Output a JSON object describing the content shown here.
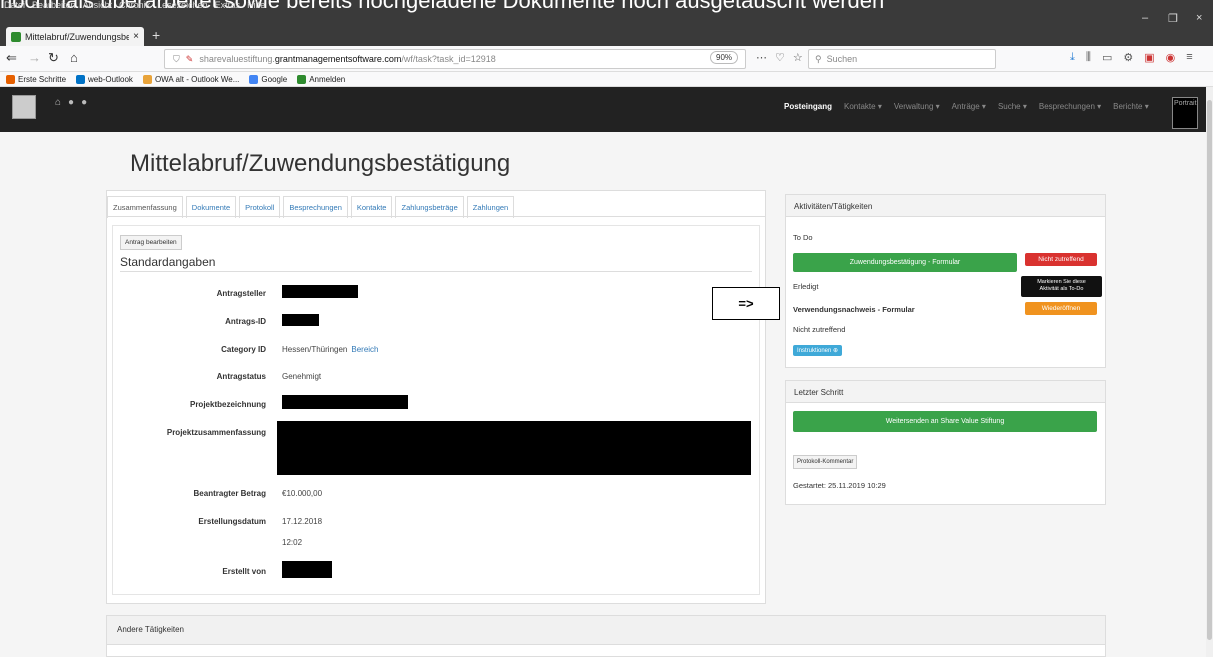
{
  "caption": "nochmals überarbeitet sowie bereits hochgeladene Dokumente noch ausgetauscht werden",
  "browser": {
    "menu": [
      "Datei",
      "Bearbeiten",
      "Ansicht",
      "Chronik",
      "Lesezeichen",
      "Extras",
      "Hilfe"
    ],
    "tab_title": "Mittelabruf/Zuwendungsbestä",
    "tab_close": "×",
    "newtab": "+",
    "url_prefix": "sharevaluestiftung.",
    "url_domain": "grantmanagementsoftware.com",
    "url_path": "/wf/task?task_id=12918",
    "zoom": "90%",
    "search_placeholder": "Suchen",
    "bookmarks": [
      "Erste Schritte",
      "web-Outlook",
      "OWA alt - Outlook We...",
      "Google",
      "Anmelden"
    ],
    "win_min": "–",
    "win_max": "❐",
    "win_close": "×"
  },
  "app": {
    "nav": [
      "Posteingang",
      "Kontakte ▾",
      "Verwaltung ▾",
      "Anträge ▾",
      "Suche ▾",
      "Besprechungen ▾",
      "Berichte ▾"
    ],
    "portrait": "Portrait"
  },
  "page": {
    "title": "Mittelabruf/Zuwendungsbestätigung",
    "tabs": [
      "Zusammenfassung",
      "Dokumente",
      "Protokoll",
      "Besprechungen",
      "Kontakte",
      "Zahlungsbeträge",
      "Zahlungen"
    ],
    "edit_button": "Antrag bearbeiten",
    "section_title": "Standardangaben",
    "fields": {
      "antragsteller": "Antragsteller",
      "antrags_id": "Antrags-ID",
      "category_id": "Category ID",
      "category_value": "Hessen/Thüringen",
      "category_link": "Bereich",
      "antragstatus": "Antragstatus",
      "antragstatus_value": "Genehmigt",
      "projektbezeichnung": "Projektbezeichnung",
      "projektzusammenfassung": "Projektzusammenfassung",
      "betrag": "Beantragter Betrag",
      "betrag_value": "€10.000,00",
      "datum": "Erstellungsdatum",
      "datum_value": "17.12.2018",
      "zeit_value": "12:02",
      "erstellt": "Erstellt von"
    },
    "arrow": "=>",
    "aktivitaeten": {
      "header": "Aktivitäten/Tätigkeiten",
      "todo": "To Do",
      "green_btn": "Zuwendungsbestätigung - Formular",
      "red_btn": "Nicht zutreffend",
      "erledigt": "Erledigt",
      "tooltip_line1": "Markieren Sie diese",
      "tooltip_line2": "Aktivität als To-Do",
      "verwendung": "Verwendungsnachweis - Formular",
      "orange_btn": "Wiederöffnen",
      "nicht": "Nicht zutreffend",
      "instruktionen": "Instruktionen"
    },
    "letzter": {
      "header": "Letzter Schritt",
      "green_btn": "Weitersenden an Share Value Stiftung",
      "protokoll": "Protokoll-Kommentar",
      "gestartet": "Gestartet: 25.11.2019 10:29"
    },
    "andere": "Andere Tätigkeiten"
  }
}
